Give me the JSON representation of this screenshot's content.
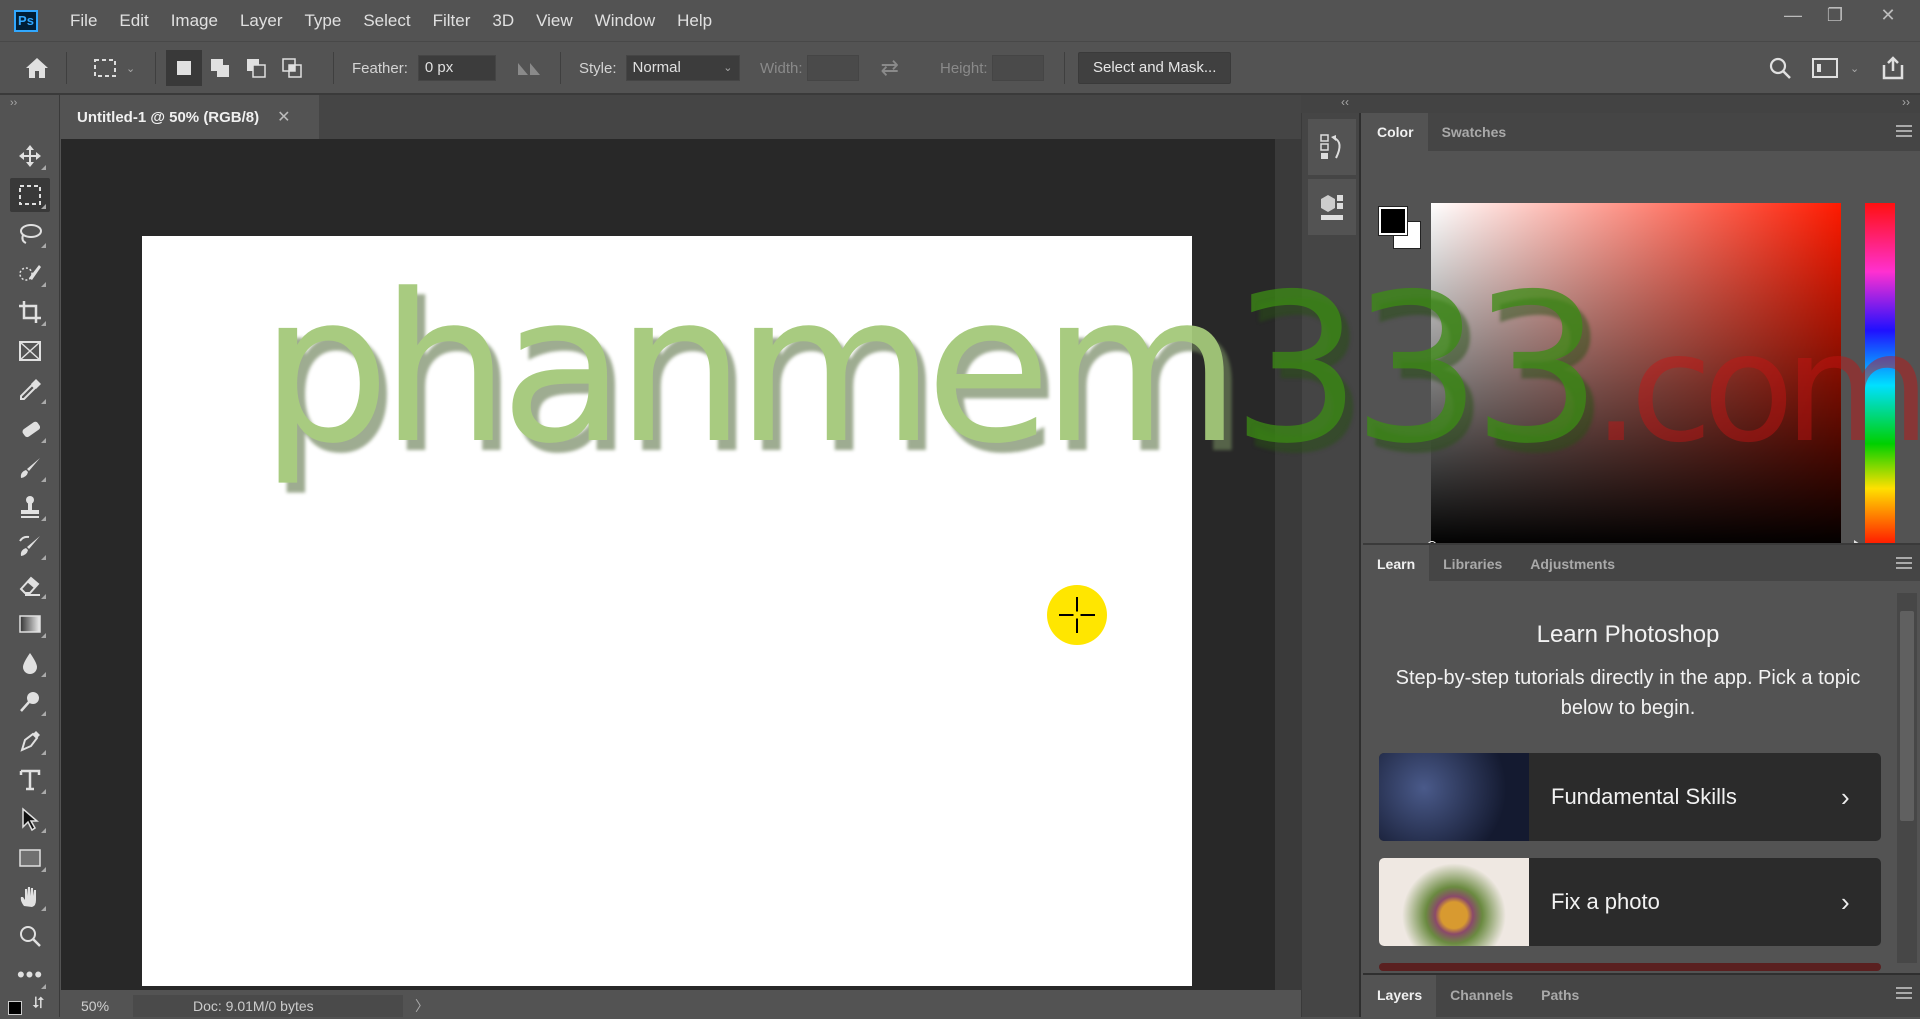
{
  "app": {
    "logo": "Ps",
    "name": "Adobe Photoshop"
  },
  "menu": [
    "File",
    "Edit",
    "Image",
    "Layer",
    "Type",
    "Select",
    "Filter",
    "3D",
    "View",
    "Window",
    "Help"
  ],
  "window_controls": {
    "minimize": "—",
    "restore": "❐",
    "close": "✕"
  },
  "options_bar": {
    "feather_label": "Feather:",
    "feather_value": "0 px",
    "style_label": "Style:",
    "style_value": "Normal",
    "width_label": "Width:",
    "width_value": "",
    "height_label": "Height:",
    "height_value": "",
    "select_mask_label": "Select and Mask...",
    "selection_modes": [
      "new-selection",
      "add-to-selection",
      "subtract-from-selection",
      "intersect-selection"
    ],
    "active_mode": "new-selection"
  },
  "tools": [
    {
      "name": "move-tool",
      "active": false
    },
    {
      "name": "rectangular-marquee-tool",
      "active": true
    },
    {
      "name": "lasso-tool",
      "active": false
    },
    {
      "name": "quick-selection-tool",
      "active": false
    },
    {
      "name": "crop-tool",
      "active": false
    },
    {
      "name": "frame-tool",
      "active": false
    },
    {
      "name": "eyedropper-tool",
      "active": false
    },
    {
      "name": "healing-brush-tool",
      "active": false
    },
    {
      "name": "brush-tool",
      "active": false
    },
    {
      "name": "clone-stamp-tool",
      "active": false
    },
    {
      "name": "history-brush-tool",
      "active": false
    },
    {
      "name": "eraser-tool",
      "active": false
    },
    {
      "name": "gradient-tool",
      "active": false
    },
    {
      "name": "blur-tool",
      "active": false
    },
    {
      "name": "dodge-tool",
      "active": false
    },
    {
      "name": "pen-tool",
      "active": false
    },
    {
      "name": "type-tool",
      "active": false
    },
    {
      "name": "path-selection-tool",
      "active": false
    },
    {
      "name": "rectangle-tool",
      "active": false
    },
    {
      "name": "hand-tool",
      "active": false
    },
    {
      "name": "zoom-tool",
      "active": false
    },
    {
      "name": "edit-toolbar",
      "active": false
    }
  ],
  "document": {
    "tab_title": "Untitled-1 @ 50% (RGB/8)",
    "close_glyph": "✕"
  },
  "watermark": {
    "part1": "phanmem",
    "part2": "333",
    "part3": ".com"
  },
  "status": {
    "zoom": "50%",
    "doc_info": "Doc: 9.01M/0 bytes",
    "arrow": "〉"
  },
  "dock": {
    "collapse_left": "‹‹",
    "collapse_right": "››"
  },
  "color_panel": {
    "tabs": [
      "Color",
      "Swatches"
    ],
    "active_tab": "Color",
    "foreground": "#000000",
    "background": "#ffffff",
    "hue_color": "#ff1a00"
  },
  "learn_panel": {
    "tabs": [
      "Learn",
      "Libraries",
      "Adjustments"
    ],
    "active_tab": "Learn",
    "title": "Learn Photoshop",
    "description": "Step-by-step tutorials directly in the app. Pick a topic below to begin.",
    "cards": [
      {
        "label": "Fundamental Skills",
        "chevron": "›"
      },
      {
        "label": "Fix a photo",
        "chevron": "›"
      }
    ]
  },
  "layers_panel": {
    "tabs": [
      "Layers",
      "Channels",
      "Paths"
    ],
    "active_tab": "Layers"
  }
}
